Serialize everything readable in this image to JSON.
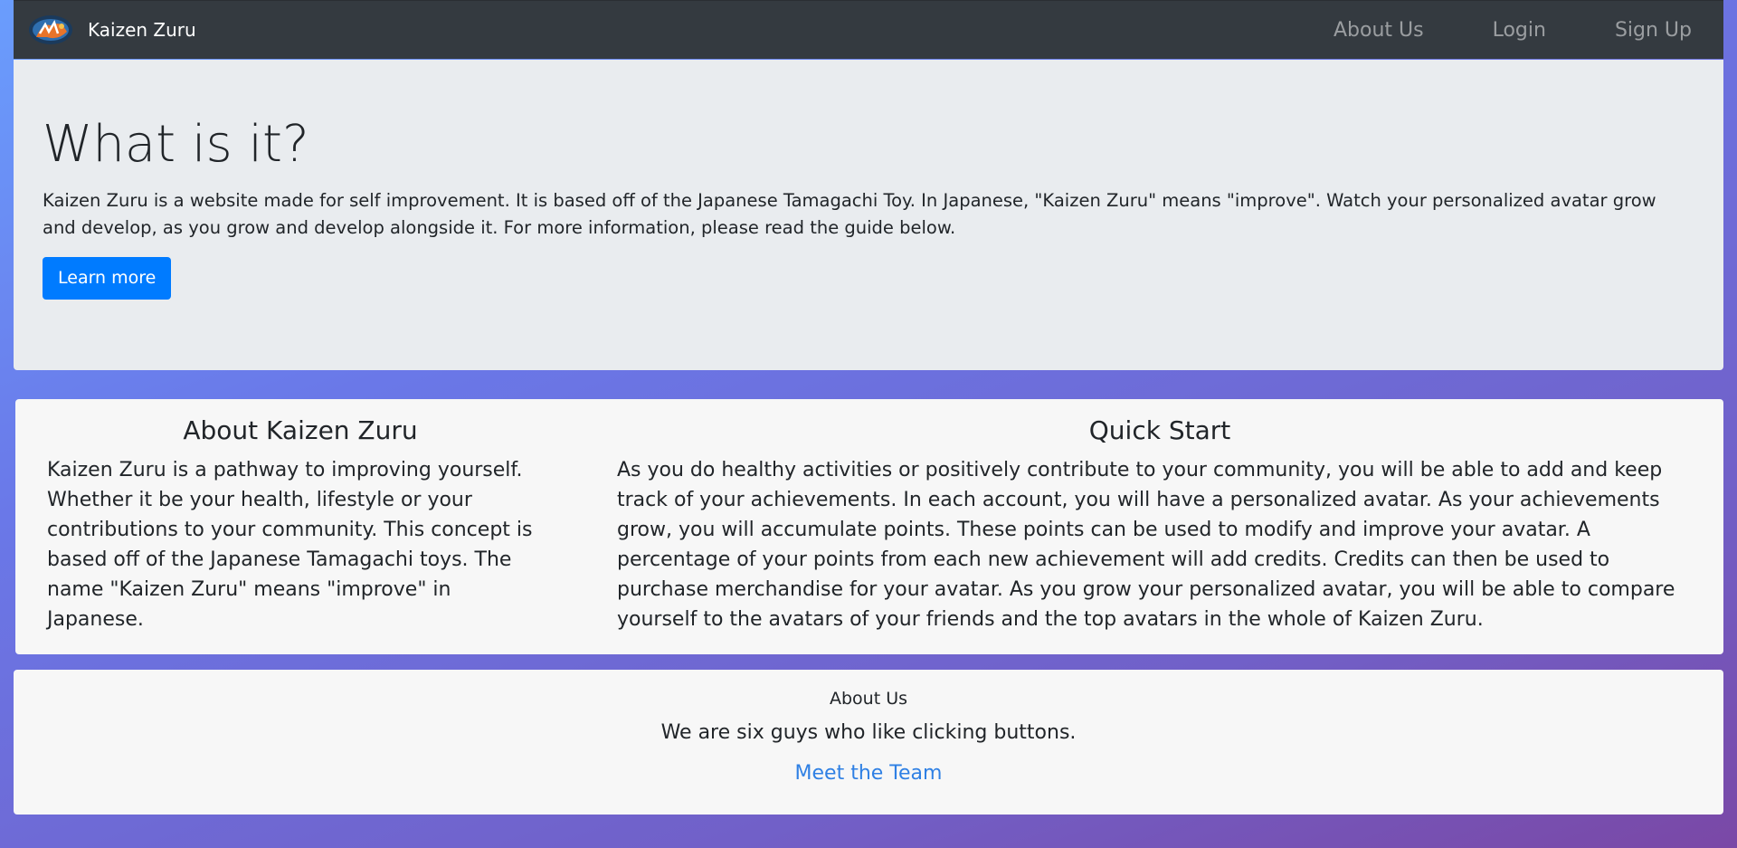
{
  "navbar": {
    "brand_name": "Kaizen Zuru",
    "logo_icon": "kaizen-zuru-logo",
    "links": [
      {
        "label": "About Us"
      },
      {
        "label": "Login"
      },
      {
        "label": "Sign Up"
      }
    ],
    "bg_color": "#343a40"
  },
  "hero": {
    "title": "What is it?",
    "lead": "Kaizen Zuru is a website made for self improvement. It is based off of the Japanese Tamagachi Toy. In Japanese, \"Kaizen Zuru\" means \"improve\". Watch your personalized avatar grow and develop, as you grow and develop alongside it. For more information, please read the guide below.",
    "button_label": "Learn more",
    "accent_color": "#007bff"
  },
  "info": {
    "about": {
      "heading": "About Kaizen Zuru",
      "text": "Kaizen Zuru is a pathway to improving yourself. Whether it be your health, lifestyle or your contributions to your community. This concept is based off of the Japanese Tamagachi toys. The name \"Kaizen Zuru\" means \"improve\" in Japanese."
    },
    "quick_start": {
      "heading": "Quick Start",
      "text": "As you do healthy activities or positively contribute to your community, you will be able to add and keep track of your achievements. In each account, you will have a personalized avatar. As your achievements grow, you will accumulate points. These points can be used to modify and improve your avatar. A percentage of your points from each new achievement will add credits. Credits can then be used to purchase merchandise for your avatar. As you grow your personalized avatar, you will be able to compare yourself to the avatars of your friends and the top avatars in the whole of Kaizen Zuru."
    }
  },
  "about_us": {
    "title": "About Us",
    "text": "We are six guys who like clicking buttons.",
    "link_label": "Meet the Team"
  }
}
